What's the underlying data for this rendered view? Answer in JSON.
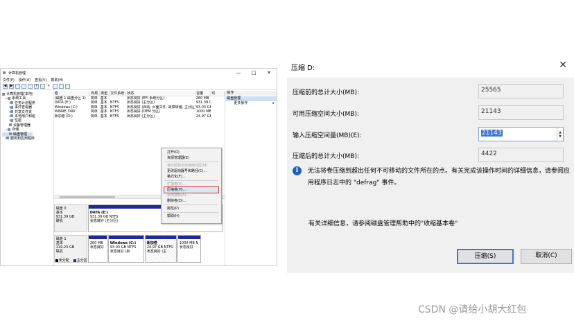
{
  "cm": {
    "title": "计算机管理",
    "window_controls": [
      "—",
      "□",
      "✕"
    ],
    "menu": [
      "文件(F)",
      "操作(A)",
      "查看(V)",
      "帮助(H)"
    ],
    "tree": [
      {
        "label": "计算机管理(本地)",
        "level": 0
      },
      {
        "label": "系统工具",
        "level": 1
      },
      {
        "label": "任务计划程序",
        "level": 2
      },
      {
        "label": "事件查看器",
        "level": 2
      },
      {
        "label": "共享文件夹",
        "level": 2
      },
      {
        "label": "本地用户和组",
        "level": 2
      },
      {
        "label": "性能",
        "level": 2
      },
      {
        "label": "设备管理器",
        "level": 2
      },
      {
        "label": "存储",
        "level": 1
      },
      {
        "label": "磁盘管理",
        "level": 2,
        "selected": true
      },
      {
        "label": "服务和应用程序",
        "level": 1
      }
    ],
    "volume_columns": [
      "卷",
      "布局",
      "类型",
      "文件系统",
      "状态",
      "容量",
      "可"
    ],
    "volumes": [
      [
        "(磁盘 1 磁盘分区 1)",
        "简单",
        "基本",
        "",
        "状态良好 (EFI 系统分区)",
        "260 MB",
        ""
      ],
      [
        "DATA (E:)",
        "简单",
        "基本",
        "NTFS",
        "状态良好 (主分区)",
        "931.39 GB",
        ""
      ],
      [
        "Windows (C:)",
        "简单",
        "基本",
        "NTFS",
        "状态良好 (启动, 页面文件, 故障转储, 主分区)",
        "93.03 GB",
        ""
      ],
      [
        "WINRE_DRV",
        "简单",
        "基本",
        "NTFS",
        "状态良好 (OEM 分区)",
        "1000 MB",
        ""
      ],
      [
        "新加卷 (D:)",
        "简单",
        "基本",
        "NTFS",
        "状态良好 (主分区)",
        "24.97 GB",
        ""
      ]
    ],
    "actions_header": "操作",
    "actions_selected": "磁盘管理",
    "actions_more": "更多操作",
    "disk0": {
      "name": "磁盘 0",
      "type": "基本",
      "size": "931.39 GB",
      "status": "联机",
      "partitions": [
        {
          "name": "DATA  (E:)",
          "size": "931.39 GB NTFS",
          "status": "状态良好 (主分区)"
        }
      ]
    },
    "disk1": {
      "name": "磁盘 1",
      "type": "基本",
      "size": "119.23 GB",
      "status": "联机",
      "partitions": [
        {
          "name": "",
          "size": "260 MB",
          "status": "状态良好"
        },
        {
          "name": "Windows (C:)",
          "size": "93.03 GB NTFS",
          "status": "状态良好 (启"
        },
        {
          "name": "新加卷",
          "size": "24.97 GB NTFS",
          "status": "状态良好 (主"
        },
        {
          "name": "",
          "size": "1000 MB N",
          "status": "状态良好"
        }
      ]
    },
    "legend": [
      "未分配",
      "主分区"
    ],
    "context_menu": [
      {
        "label": "打开(O)",
        "state": "normal"
      },
      {
        "label": "资源管理器(E)",
        "state": "normal"
      },
      {
        "sep": true
      },
      {
        "label": "将分区标记为活动分区(M)",
        "state": "disabled"
      },
      {
        "label": "更改驱动器号和路径(C)...",
        "state": "normal"
      },
      {
        "label": "格式化(F)...",
        "state": "normal"
      },
      {
        "sep": true
      },
      {
        "label": "扩展卷(X)...",
        "state": "disabled"
      },
      {
        "label": "压缩卷(H)...",
        "state": "highlight"
      },
      {
        "label": "添加镜像(A)...",
        "state": "disabled"
      },
      {
        "label": "删除卷(D)...",
        "state": "normal"
      },
      {
        "sep": true
      },
      {
        "label": "属性(P)",
        "state": "normal"
      },
      {
        "sep": true
      },
      {
        "label": "帮助(H)",
        "state": "normal"
      }
    ]
  },
  "dialog": {
    "title": "压缩 D:",
    "fields": [
      {
        "label": "压缩前的总计大小(MB):",
        "value": "25565"
      },
      {
        "label": "可用压缩空间大小(MB):",
        "value": "21143"
      },
      {
        "label": "输入压缩空间量(MB)(E):",
        "value": "21143"
      },
      {
        "label": "压缩后的总计大小(MB):",
        "value": "4422"
      }
    ],
    "info": "无法将卷压缩到超出任何不可移动的文件所在的点。有关完成该操作时间的详细信息，请参阅应用程序日志中的 \"defrag\" 事件。",
    "help": "有关详细信息，请参阅磁盘管理帮助中的\"收缩基本卷\"",
    "ok_label": "压缩(S)",
    "cancel_label": "取消(C)"
  },
  "watermark": "CSDN @请给小胡大红包"
}
